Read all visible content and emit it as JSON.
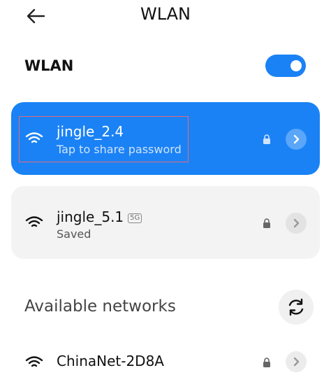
{
  "header": {
    "title": "WLAN",
    "back_icon": "arrow-left-icon"
  },
  "wlan_toggle": {
    "label": "WLAN",
    "enabled": true,
    "accent_color": "#1a82f5"
  },
  "networks_saved": [
    {
      "ssid": "jingle_2.4",
      "status": "Tap to share password",
      "connected": true,
      "locked": true,
      "band_badge": ""
    },
    {
      "ssid": "jingle_5.1",
      "status": "Saved",
      "connected": false,
      "locked": true,
      "band_badge": "5G"
    }
  ],
  "available": {
    "title": "Available networks",
    "refresh_icon": "refresh-icon",
    "items": [
      {
        "ssid": "ChinaNet-2D8A",
        "locked": true
      }
    ]
  }
}
